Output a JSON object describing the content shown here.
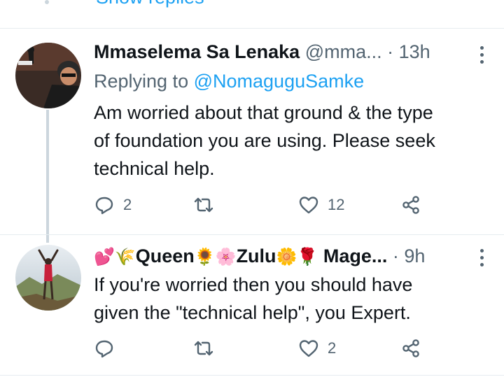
{
  "top": {
    "show_replies_label": "Show replies"
  },
  "tweets": [
    {
      "display_name": "Mmaselema Sa Lenaka",
      "handle": "@mma...",
      "separator": "·",
      "time": "13h",
      "replying_prefix": "Replying to",
      "replying_to": "@NomaguguSamke",
      "lines": [
        "Am worried about that ground & the type",
        "of foundation you are using. Please seek",
        "technical help."
      ],
      "reply_count": "2",
      "retweet_count": "",
      "like_count": "12"
    },
    {
      "name_prefix_emoji": "💕🌾",
      "name_part1": "Queen",
      "emoji_1": "🌻🌸",
      "name_part2": "Zulu",
      "emoji_2": "🌼🌹",
      "name_part3": "Mage...",
      "separator": "·",
      "time": "9h",
      "lines": [
        "If you're worried then you should have",
        "given the \"technical help\", you Expert."
      ],
      "reply_count": "",
      "retweet_count": "",
      "like_count": "2"
    }
  ],
  "icons": [
    "reply-icon",
    "retweet-icon",
    "like-icon",
    "share-icon",
    "more-icon"
  ],
  "colors": {
    "accent": "#1da1f2",
    "secondary_text": "#536471",
    "thread_line": "#ccd6dd"
  }
}
